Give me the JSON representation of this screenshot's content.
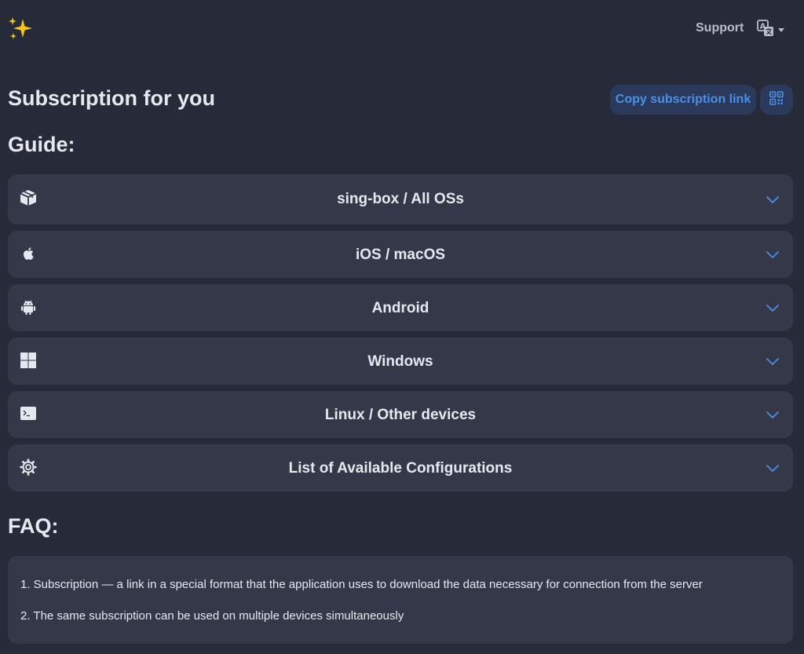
{
  "header": {
    "logo_icon": "sparkles-icon",
    "support_label": "Support",
    "language_icon": "translate-icon"
  },
  "title": "Subscription for you",
  "actions": {
    "copy_link_label": "Copy subscription link",
    "qr_icon": "qr-code-icon"
  },
  "guide": {
    "title": "Guide:",
    "items": [
      {
        "label": "sing-box / All OSs",
        "icon": "box-icon"
      },
      {
        "label": "iOS / macOS",
        "icon": "apple-icon"
      },
      {
        "label": "Android",
        "icon": "android-icon"
      },
      {
        "label": "Windows",
        "icon": "windows-icon"
      },
      {
        "label": "Linux / Other devices",
        "icon": "terminal-icon"
      },
      {
        "label": "List of Available Configurations",
        "icon": "gear-icon"
      }
    ]
  },
  "faq": {
    "title": "FAQ:",
    "items": [
      "1. Subscription — a link in a special format that the application uses to download the data necessary for connection from the server",
      "2. The same subscription can be used on multiple devices simultaneously"
    ]
  },
  "colors": {
    "background": "#272a38",
    "panel": "#353849",
    "accent": "#4a90e8",
    "accent_bg": "#2b3a5a",
    "sparkle": "#f5c518"
  }
}
